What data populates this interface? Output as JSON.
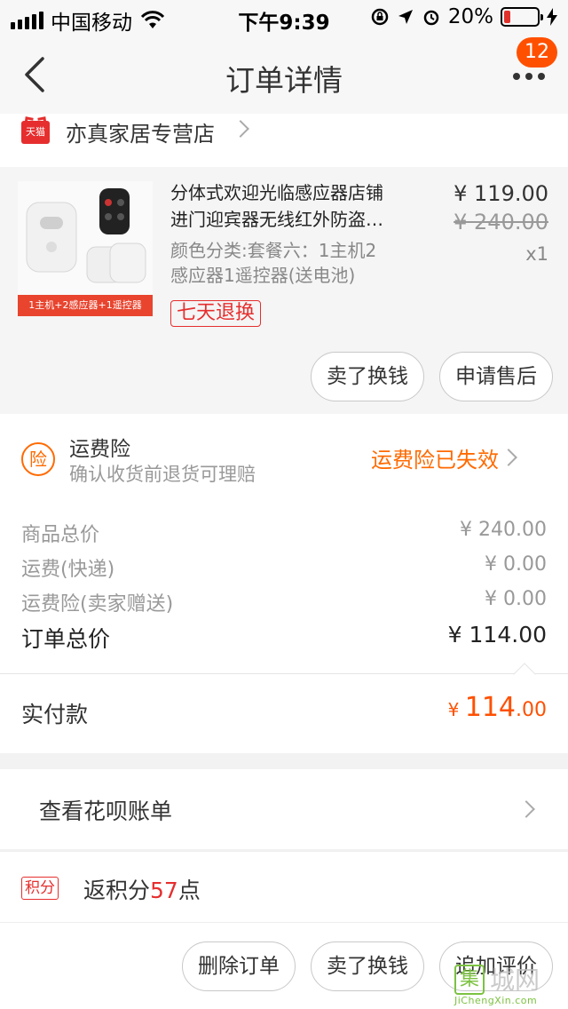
{
  "status_bar": {
    "carrier": "中国移动",
    "time": "下午9:39",
    "battery_percent": "20%",
    "battery_level": 0.2,
    "icons": [
      "signal-icon",
      "wifi-icon",
      "orientation-lock-icon",
      "location-icon",
      "alarm-icon",
      "battery-icon",
      "charging-icon"
    ]
  },
  "nav": {
    "title": "订单详情",
    "badge_count": "12"
  },
  "shop": {
    "badge": "天猫",
    "name": "亦真家居专营店"
  },
  "product": {
    "title_line1": "分体式欢迎光临感应器店铺",
    "title_line2": "进门迎宾器无线红外防盗…",
    "sku_line1": "颜色分类:套餐六：1主机2",
    "sku_line2": "感应器1遥控器(送电池)",
    "price_now": "¥ 119.00",
    "price_old": "¥ 240.00",
    "quantity": "x1",
    "thumb_caption": "1主机+2感应器+1遥控器",
    "return_tag": "七天退换",
    "sell_button": "卖了换钱",
    "after_sale_button": "申请售后"
  },
  "insurance": {
    "icon_char": "险",
    "title": "运费险",
    "desc": "确认收货前退货可理赔",
    "status": "运费险已失效"
  },
  "summary": {
    "rows": [
      {
        "label": "商品总价",
        "value": "¥ 240.00"
      },
      {
        "label": "运费(快递)",
        "value": "¥ 0.00"
      },
      {
        "label": "运费险(卖家赠送)",
        "value": "¥ 0.00"
      }
    ],
    "total_label": "订单总价",
    "total_value": "¥ 114.00"
  },
  "paid": {
    "label": "实付款",
    "currency": "¥ ",
    "amount_int": "114",
    "amount_dec": ".00"
  },
  "huabei": {
    "label": "查看花呗账单"
  },
  "points": {
    "badge": "积分",
    "prefix": "返积分",
    "number": "57",
    "suffix": "点"
  },
  "actions": {
    "delete": "删除订单",
    "sell": "卖了换钱",
    "review": "追加评价"
  },
  "watermark": {
    "char": "集",
    "text": "城网",
    "url": "JiChengXin.com"
  }
}
